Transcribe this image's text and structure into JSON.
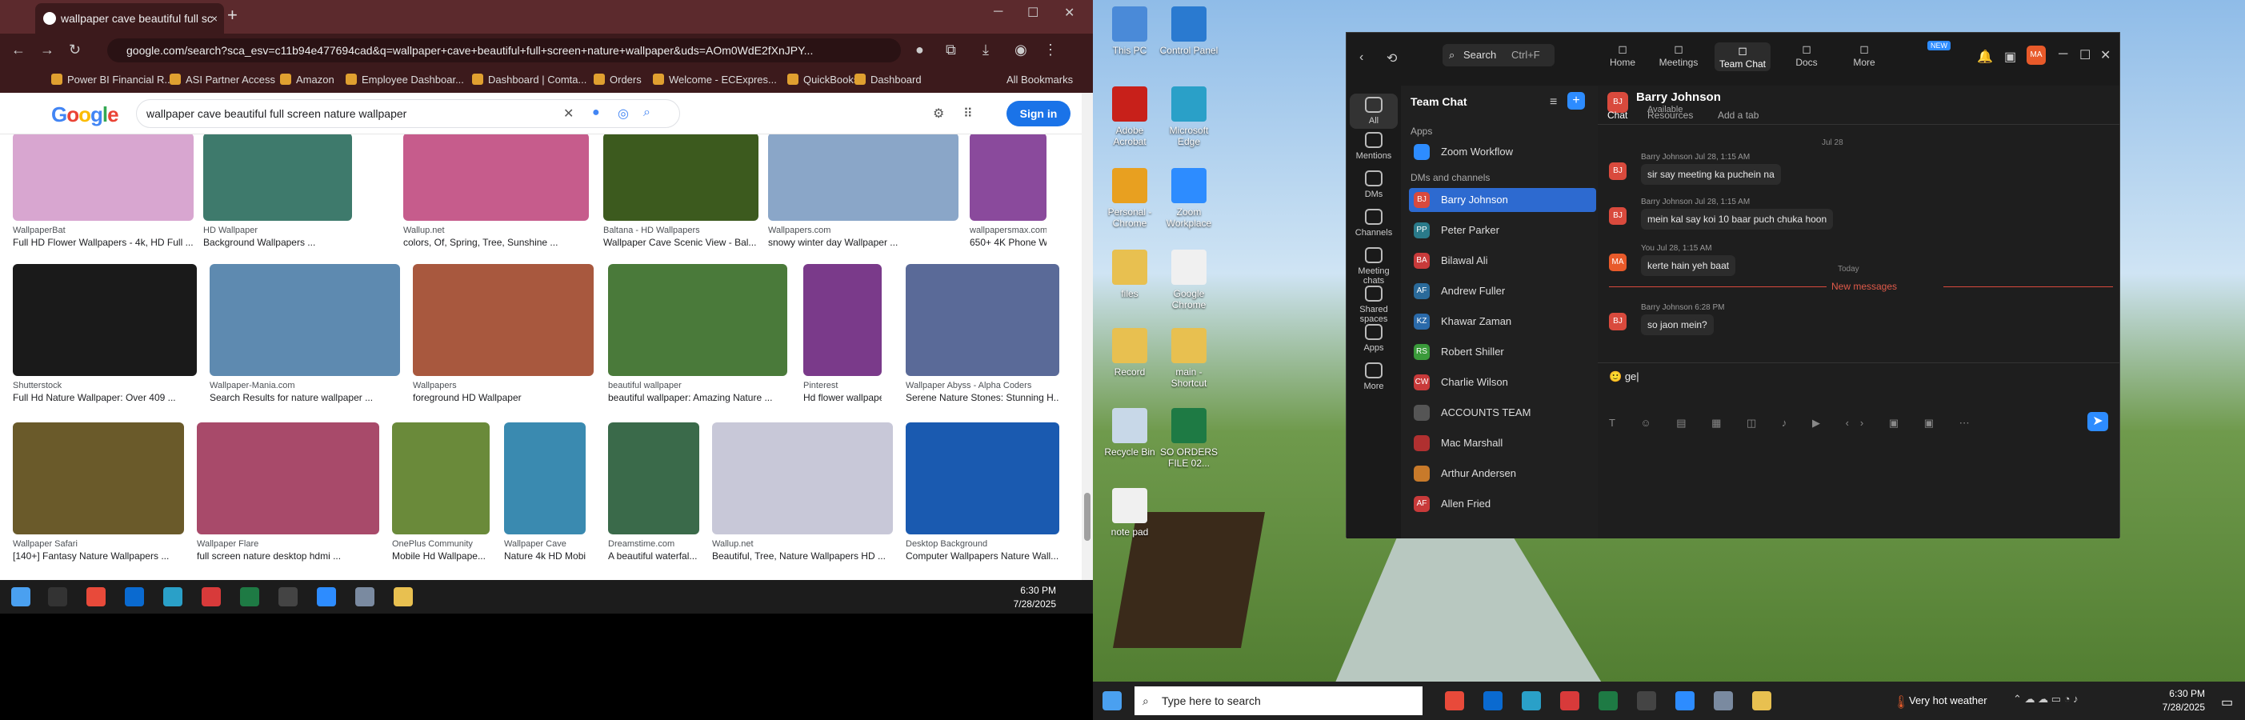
{
  "browser": {
    "tab_title": "wallpaper cave beautiful full sc",
    "url": "google.com/search?sca_esv=c11b94e477694cad&q=wallpaper+cave+beautiful+full+screen+nature+wallpaper&uds=AOm0WdE2fXnJPY...",
    "bookmarks": [
      "Power BI Financial R...",
      "ASI Partner Access",
      "Amazon",
      "Employee Dashboar...",
      "Dashboard | Comta...",
      "Orders",
      "Welcome - ECExpres...",
      "QuickBooks",
      "Dashboard"
    ],
    "all_bookmarks": "All Bookmarks"
  },
  "google": {
    "logo": "Google",
    "query": "wallpaper cave beautiful full screen nature wallpaper",
    "sign_in": "Sign in"
  },
  "results": [
    {
      "src": "WallpaperBat",
      "cap": "Full HD Flower Wallpapers - 4k, HD Full ...",
      "color": "#d8a6d0"
    },
    {
      "src": "HD Wallpaper",
      "cap": "Background Wallpapers ...",
      "color": "#3e7a6c"
    },
    {
      "src": "Wallup.net",
      "cap": "colors, Of, Spring, Tree, Sunshine ...",
      "color": "#c65c8c"
    },
    {
      "src": "Baltana - HD Wallpapers",
      "cap": "Wallpaper Cave Scenic View - Bal...",
      "color": "#3c5a1e"
    },
    {
      "src": "Wallpapers.com",
      "cap": "snowy winter day Wallpaper ...",
      "color": "#8aa6c8"
    },
    {
      "src": "wallpapersmax.com",
      "cap": "650+ 4K Phone W...",
      "color": "#8a4a9c"
    },
    {
      "src": "Shutterstock",
      "cap": "Full Hd Nature Wallpaper: Over 409 ...",
      "color": "#1a1a1a"
    },
    {
      "src": "Wallpaper-Mania.com",
      "cap": "Search Results for nature wallpaper ...",
      "color": "#5e8ab0"
    },
    {
      "src": "Wallpapers",
      "cap": "foreground HD Wallpaper",
      "color": "#a8583e"
    },
    {
      "src": "beautiful wallpaper",
      "cap": "beautiful wallpaper: Amazing Nature ...",
      "color": "#4a7a3a"
    },
    {
      "src": "Pinterest",
      "cap": "Hd flower wallpape...",
      "color": "#7a3a8a"
    },
    {
      "src": "Wallpaper Abyss - Alpha Coders",
      "cap": "Serene Nature Stones: Stunning H...",
      "color": "#5a6a98"
    },
    {
      "src": "Wallpaper Safari",
      "cap": "[140+] Fantasy Nature Wallpapers ...",
      "color": "#6a5a2a"
    },
    {
      "src": "Wallpaper Flare",
      "cap": "full screen nature desktop hdmi ...",
      "color": "#a84a6a"
    },
    {
      "src": "OnePlus Community",
      "cap": "Mobile Hd Wallpape...",
      "color": "#6a8a3a"
    },
    {
      "src": "Wallpaper Cave",
      "cap": "Nature 4k HD Mobi...",
      "color": "#3a8ab0"
    },
    {
      "src": "Dreamstime.com",
      "cap": "A beautiful waterfal...",
      "color": "#3a6a4a"
    },
    {
      "src": "Wallup.net",
      "cap": "Beautiful, Tree, Nature Wallpapers HD ...",
      "color": "#c8c8d8"
    },
    {
      "src": "Desktop Background",
      "cap": "Computer Wallpapers Nature Wall...",
      "color": "#1a5ab0"
    }
  ],
  "taskbar_left": {
    "time": "6:30 PM",
    "date": "7/28/2025"
  },
  "desktop": {
    "icons": [
      {
        "label": "This PC",
        "color": "#4a8ad8"
      },
      {
        "label": "Control Panel",
        "color": "#2a7ad0"
      },
      {
        "label": "Adobe Acrobat",
        "color": "#c8201a"
      },
      {
        "label": "Microsoft Edge",
        "color": "#2aa0c8"
      },
      {
        "label": "Personal - Chrome",
        "color": "#e8a020"
      },
      {
        "label": "Zoom Workplace",
        "color": "#2d8cff"
      },
      {
        "label": "files",
        "color": "#e8c050"
      },
      {
        "label": "Google Chrome",
        "color": "#f0f0f0"
      },
      {
        "label": "Record",
        "color": "#e8c050"
      },
      {
        "label": "main - Shortcut",
        "color": "#e8c050"
      },
      {
        "label": "Recycle Bin",
        "color": "#c8d8e8"
      },
      {
        "label": "SO ORDERS FILE 02...",
        "color": "#1e7a44"
      },
      {
        "label": "note pad",
        "color": "#f0f0f0"
      }
    ]
  },
  "zoom": {
    "search": "Search",
    "search_shortcut": "Ctrl+F",
    "nav": [
      "Home",
      "Meetings",
      "Team Chat",
      "Docs",
      "More"
    ],
    "new_badge": "NEW",
    "avatar": "MA",
    "sidebar": [
      "All",
      "Mentions",
      "DMs",
      "Channels",
      "Meeting chats",
      "Shared spaces",
      "Apps",
      "More"
    ],
    "list_title": "Team Chat",
    "sections": [
      "Apps",
      "DMs and channels"
    ],
    "apps": [
      "Zoom Workflow"
    ],
    "contacts": [
      {
        "name": "Barry Johnson",
        "initials": "BJ",
        "color": "#d94a3d"
      },
      {
        "name": "Peter Parker",
        "initials": "PP",
        "color": "#2a7a8a"
      },
      {
        "name": "Bilawal Ali",
        "initials": "BA",
        "color": "#c83a3a"
      },
      {
        "name": "Andrew Fuller",
        "initials": "AF",
        "color": "#2a6a9a"
      },
      {
        "name": "Khawar Zaman",
        "initials": "KZ",
        "color": "#2a6aaa"
      },
      {
        "name": "Robert Shiller",
        "initials": "RS",
        "color": "#3a9a3a"
      },
      {
        "name": "Charlie Wilson",
        "initials": "CW",
        "color": "#c83a3a"
      },
      {
        "name": "ACCOUNTS TEAM",
        "initials": "",
        "color": "#555"
      },
      {
        "name": "Mac Marshall",
        "initials": "",
        "color": "#b03030"
      },
      {
        "name": "Arthur Andersen",
        "initials": "",
        "color": "#c87a2a"
      },
      {
        "name": "Allen Fried",
        "initials": "AF",
        "color": "#c83a3a"
      }
    ],
    "chat_name": "Barry Johnson",
    "chat_status": "Available",
    "chat_tabs": [
      "Chat",
      "Resources",
      "Add a tab"
    ],
    "date1": "Jul 28",
    "messages": [
      {
        "meta": "Barry Johnson  Jul 28, 1:15 AM",
        "text": "sir say meeting ka puchein na",
        "av": "BJ"
      },
      {
        "meta": "Barry Johnson  Jul 28, 1:15 AM",
        "text": "mein kal say koi 10 baar puch chuka hoon",
        "av": "BJ"
      },
      {
        "meta": "You  Jul 28, 1:15 AM",
        "text": "kerte hain yeh baat",
        "av": "MA"
      }
    ],
    "today": "Today",
    "new_messages": "New messages",
    "new_msg": {
      "meta": "Barry Johnson  6:28 PM",
      "text": "so jaon mein?",
      "av": "BJ"
    },
    "compose": "ge"
  },
  "taskbar_right": {
    "search": "Type here to search",
    "weather": "Very hot weather",
    "time": "6:30 PM",
    "date": "7/28/2025"
  }
}
